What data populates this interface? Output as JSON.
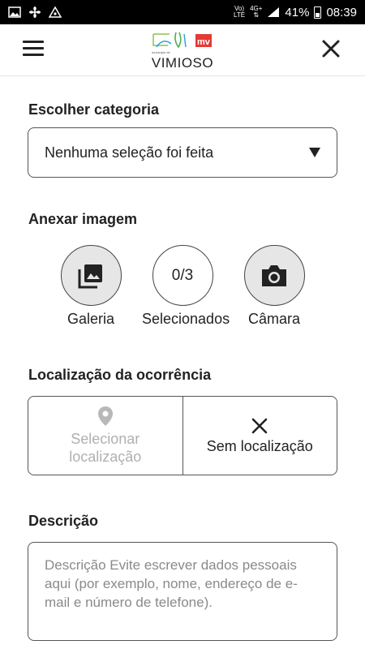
{
  "status_bar": {
    "net_top": "Vo)",
    "net_bottom": "LTE",
    "net2_top": "4G+",
    "battery": "41%",
    "time": "08:39",
    "icons": [
      "image-icon",
      "fan-icon",
      "triangle-icon"
    ]
  },
  "header": {
    "logo_subtitle": "município de",
    "logo_title": "VIMIOSO",
    "brand_colors": {
      "green": "#8bc34a",
      "blue": "#2ea3d8",
      "red": "#e53935"
    }
  },
  "category": {
    "label": "Escolher categoria",
    "selected": "Nenhuma seleção foi feita"
  },
  "attach": {
    "label": "Anexar imagem",
    "gallery_label": "Galeria",
    "selected_count": "0/3",
    "selected_label": "Selecionados",
    "camera_label": "Câmara"
  },
  "location": {
    "label": "Localização da ocorrência",
    "select_line1": "Selecionar",
    "select_line2": "localização",
    "none_label": "Sem localização"
  },
  "description": {
    "label": "Descrição",
    "placeholder": "Descrição Evite escrever dados pessoais aqui (por exemplo, nome, endereço de e-mail e número de telefone)."
  }
}
